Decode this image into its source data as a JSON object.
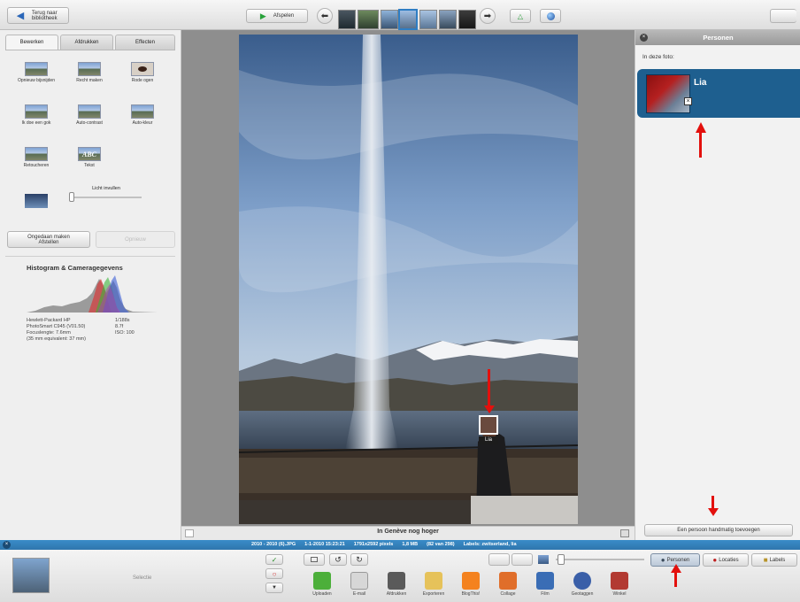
{
  "topbar": {
    "back_label": "Terug naar bibliotheek",
    "play_label": "Afspelen"
  },
  "left": {
    "tabs": [
      "Bewerken",
      "Afdrukken",
      "Effecten"
    ],
    "tools": [
      {
        "label": "Opnieuw bijsnijden",
        "icon": "crop-icon"
      },
      {
        "label": "Recht maken",
        "icon": "straighten-icon"
      },
      {
        "label": "Rode ogen",
        "icon": "red-eye-icon"
      },
      {
        "label": "Ik doe een gok",
        "icon": "lucky-icon"
      },
      {
        "label": "Auto-contrast",
        "icon": "contrast-icon"
      },
      {
        "label": "Auto-kleur",
        "icon": "color-icon"
      },
      {
        "label": "Retoucheren",
        "icon": "retouch-icon"
      },
      {
        "label": "Tekst",
        "icon": "text-icon"
      }
    ],
    "text_icon_glyph": "ABC",
    "fill_light_label": "Licht invullen",
    "undo_button": "Ongedaan maken Afstellen",
    "redo_button": "Opnieuw",
    "histogram_title": "Histogram & Cameragegevens",
    "camera_left": [
      "Hewlett-Packard HP",
      "PhotoSmart C945 (V01.50)",
      "Focuslengte: 7.6mm",
      "(35 mm equivalent: 37 mm)"
    ],
    "camera_right": [
      "1/188s",
      "8.7f",
      "ISO: 100",
      ""
    ]
  },
  "photo": {
    "face_tag": "Lia"
  },
  "caption": {
    "text": "In Genève nog hoger"
  },
  "right": {
    "title": "Personen",
    "subtitle": "In deze foto:",
    "person_name": "Lia",
    "add_button": "Een persoon handmatig toevoegen"
  },
  "statusbar": {
    "items": [
      "2010 - 2010 (6).JPG",
      "1-1-2010 15:23:21",
      "1791x2592 pixels",
      "1,8 MB",
      "(82 van 298)",
      "Labels: zwitserland, lia"
    ]
  },
  "bottom": {
    "selection_label": "Selectie",
    "actions": [
      "Uploaden",
      "E-mail",
      "Afdrukken",
      "Exporteren",
      "BlogThis!",
      "Collage",
      "Film",
      "Geotaggen",
      "Winkel"
    ],
    "action_icons": [
      "upload-icon",
      "email-icon",
      "print-icon",
      "export-icon",
      "blogger-icon",
      "collage-icon",
      "movie-icon",
      "geotag-icon",
      "shop-icon"
    ],
    "action_colors": [
      "#4caf3a",
      "#d7d7d7",
      "#5a5a5a",
      "#e6c25a",
      "#f4821f",
      "#e06e2a",
      "#3a6db5",
      "#3a5fa8",
      "#b23a32"
    ],
    "right_tabs": [
      "Personen",
      "Locaties",
      "Labels"
    ]
  },
  "colors": {
    "statusbar": "#3a8cc8",
    "panel_header": "#a4a4a4",
    "person_card": "#1e5f8f",
    "annotation_arrow": "#e3100d"
  }
}
